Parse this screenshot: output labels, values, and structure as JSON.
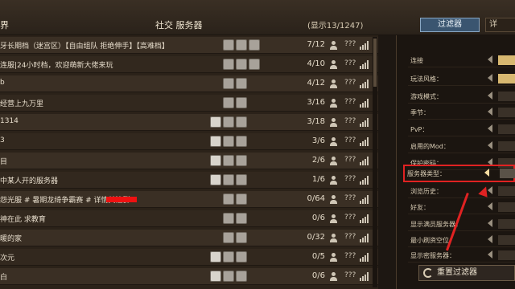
{
  "header": {
    "left_text": "界",
    "title": "社交 服务器",
    "count_text": "(显示13/1247)"
  },
  "servers": [
    {
      "name": "牙长期档（迷宫区）【自由组队 拒绝伸手】【高难档】",
      "count": "7/12",
      "ping": "???",
      "lock": false
    },
    {
      "name": "连服|24小时档，欢迎萌新大佬来玩",
      "count": "4/10",
      "ping": "???",
      "lock": false
    },
    {
      "name": "b",
      "count": "4/12",
      "ping": "???",
      "lock": false
    },
    {
      "name": "经营上九万里",
      "count": "3/16",
      "ping": "???",
      "lock": false
    },
    {
      "name": "1314",
      "count": "3/18",
      "ping": "???",
      "lock": true
    },
    {
      "name": "3",
      "count": "3/6",
      "ping": "???",
      "lock": true
    },
    {
      "name": "目",
      "count": "2/6",
      "ping": "???",
      "lock": true
    },
    {
      "name": "中某人开的服务器",
      "count": "1/6",
      "ping": "???",
      "lock": true
    },
    {
      "name": "怨光服 # 暑期龙绮争霸赛 # 详情关注群6",
      "count": "0/64",
      "ping": "???",
      "lock": false,
      "redacted": true
    },
    {
      "name": "神在此 求教育",
      "count": "0/6",
      "ping": "???",
      "lock": false
    },
    {
      "name": "暖的家",
      "count": "0/32",
      "ping": "???",
      "lock": false
    },
    {
      "name": "次元",
      "count": "0/5",
      "ping": "???",
      "lock": true
    },
    {
      "name": "白",
      "count": "0/6",
      "ping": "???",
      "lock": true
    }
  ],
  "filter_panel": {
    "active_tab": "过滤器",
    "inactive_tab": "详",
    "items": [
      {
        "label": "连接",
        "value": "gold"
      },
      {
        "label": "玩法风格：",
        "value": "gold"
      },
      {
        "label": "游戏模式：",
        "value": ""
      },
      {
        "label": "季节：",
        "value": ""
      },
      {
        "label": "PvP：",
        "value": ""
      },
      {
        "label": "启用的Mod：",
        "value": ""
      },
      {
        "label": "保护密码：",
        "value": ""
      },
      {
        "label": "服务器类型：",
        "value": "",
        "highlight": true
      },
      {
        "label": "浏览历史：",
        "value": ""
      },
      {
        "label": "好友：",
        "value": ""
      },
      {
        "label": "显示满员服务器：",
        "value": ""
      },
      {
        "label": "最小刷资空位：",
        "value": ""
      },
      {
        "label": "显示密服务器：",
        "value": ""
      }
    ],
    "reset_label": "重置过滤器"
  }
}
